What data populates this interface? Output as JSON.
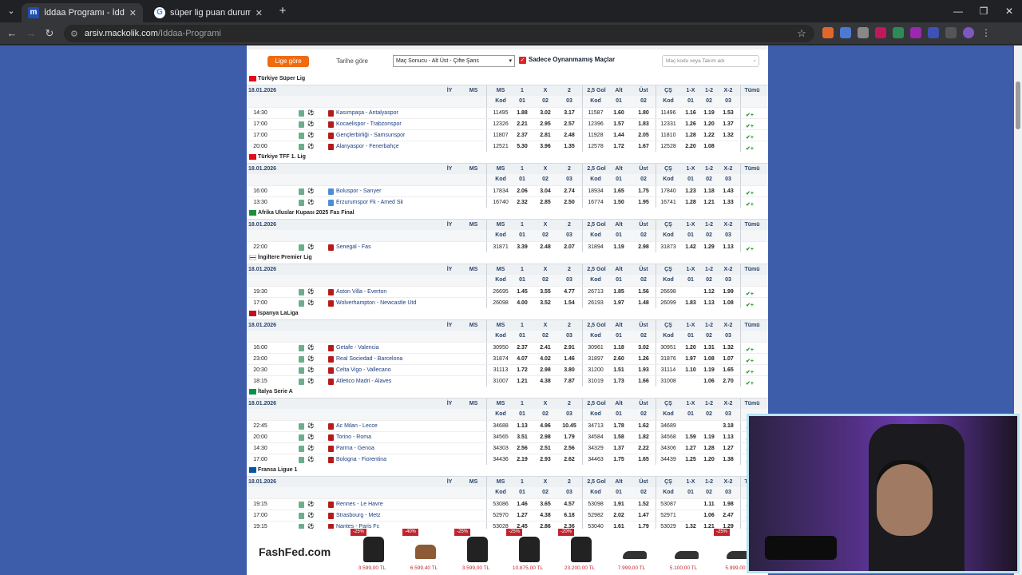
{
  "tabs": [
    {
      "title": "İddaa Programı - İddaa sonuçları",
      "icon": "mackolik-favicon"
    },
    {
      "title": "süper lig puan durum - Google Arama",
      "icon": "google-favicon"
    }
  ],
  "address": {
    "domain": "arsiv.mackolik.com",
    "path": "/Iddaa-Programi"
  },
  "filters": {
    "lige_gore": "Lige göre",
    "tarihe_gore": "Tarihe göre",
    "market_select": "Maç Sonucu - Alt Üst - Çifte Şans",
    "only_unplayed": "Sadece Oynanmamış Maçlar",
    "search_placeholder": "Maç kodu veya Takım adı"
  },
  "headers": {
    "iy": "İY",
    "ms": "MS",
    "ms2": "MS",
    "one": "1",
    "x": "X",
    "two": "2",
    "gol": "2,5 Gol",
    "alt": "Alt",
    "ust": "Üst",
    "cs": "ÇŞ",
    "one_x": "1-X",
    "one_two": "1-2",
    "x_two": "X-2",
    "all": "Tümü",
    "kod": "Kod",
    "c01": "01",
    "c02": "02",
    "c03": "03"
  },
  "leagues": [
    {
      "name": "Türkiye Süper Lig",
      "flag": "tr",
      "date": "18.01.2026",
      "matches": [
        [
          "14:30",
          "Kasımpaşa - Antalyaspor",
          "11495",
          "1.88",
          "3.02",
          "3.17",
          "11587",
          "1.60",
          "1.80",
          "11496",
          "1.16",
          "1.19",
          "1.53"
        ],
        [
          "17:00",
          "Kocaelispor - Trabzonspor",
          "12326",
          "2.21",
          "2.95",
          "2.57",
          "12396",
          "1.57",
          "1.83",
          "12331",
          "1.26",
          "1.20",
          "1.37"
        ],
        [
          "17:00",
          "Gençlerbirliği - Samsunspor",
          "11807",
          "2.37",
          "2.81",
          "2.48",
          "11928",
          "1.44",
          "2.05",
          "11810",
          "1.28",
          "1.22",
          "1.32"
        ],
        [
          "20:00",
          "Alanyaspor - Fenerbahçe",
          "12521",
          "5.30",
          "3.96",
          "1.35",
          "12578",
          "1.72",
          "1.67",
          "12528",
          "2.20",
          "1.08",
          ""
        ]
      ]
    },
    {
      "name": "Türkiye TFF 1. Lig",
      "flag": "tr",
      "date": "18.01.2026",
      "matches": [
        [
          "16:00",
          "Boluspor - Sarıyer",
          "17834",
          "2.06",
          "3.04",
          "2.74",
          "18934",
          "1.65",
          "1.75",
          "17840",
          "1.23",
          "1.18",
          "1.43"
        ],
        [
          "13:30",
          "Erzurumspor Fk - Amed Sk",
          "16740",
          "2.32",
          "2.85",
          "2.50",
          "16774",
          "1.50",
          "1.95",
          "16741",
          "1.28",
          "1.21",
          "1.33"
        ]
      ]
    },
    {
      "name": "Afrika Uluslar Kupası 2025 Fas Final",
      "flag": "af",
      "date": "18.01.2026",
      "matches": [
        [
          "22:00",
          "Senegal - Fas",
          "31871",
          "3.39",
          "2.48",
          "2.07",
          "31894",
          "1.19",
          "2.98",
          "31873",
          "1.42",
          "1.29",
          "1.13"
        ]
      ]
    },
    {
      "name": "İngiltere Premier Lig",
      "flag": "en",
      "date": "18.01.2026",
      "matches": [
        [
          "19:30",
          "Aston Villa - Everton",
          "26695",
          "1.45",
          "3.55",
          "4.77",
          "26713",
          "1.85",
          "1.56",
          "26698",
          "",
          "1.12",
          "1.99"
        ],
        [
          "17:00",
          "Wolverhampton - Newcastle Utd",
          "26098",
          "4.00",
          "3.52",
          "1.54",
          "26193",
          "1.97",
          "1.48",
          "26099",
          "1.83",
          "1.13",
          "1.08"
        ]
      ]
    },
    {
      "name": "İspanya LaLiga",
      "flag": "es",
      "date": "18.01.2026",
      "matches": [
        [
          "16:00",
          "Getafe - Valencia",
          "30950",
          "2.37",
          "2.41",
          "2.91",
          "30961",
          "1.18",
          "3.02",
          "30951",
          "1.20",
          "1.31",
          "1.32"
        ],
        [
          "23:00",
          "Real Sociedad - Barcelona",
          "31874",
          "4.07",
          "4.02",
          "1.46",
          "31897",
          "2.60",
          "1.26",
          "31876",
          "1.97",
          "1.08",
          "1.07"
        ],
        [
          "20:30",
          "Celta Vigo - Vallecano",
          "31113",
          "1.72",
          "2.98",
          "3.80",
          "31200",
          "1.51",
          "1.93",
          "31114",
          "1.10",
          "1.19",
          "1.65"
        ],
        [
          "18:15",
          "Atletico Madri - Alaves",
          "31007",
          "1.21",
          "4.38",
          "7.87",
          "31019",
          "1.73",
          "1.66",
          "31008",
          "",
          "1.06",
          "2.70"
        ]
      ]
    },
    {
      "name": "İtalya Serie A",
      "flag": "it",
      "date": "18.01.2026",
      "matches": [
        [
          "22:45",
          "Ac Milan - Lecce",
          "34688",
          "1.13",
          "4.96",
          "10.45",
          "34713",
          "1.78",
          "1.62",
          "34689",
          "",
          "",
          "3.18"
        ],
        [
          "20:00",
          "Torino - Roma",
          "34565",
          "3.51",
          "2.98",
          "1.79",
          "34584",
          "1.58",
          "1.82",
          "34568",
          "1.59",
          "1.19",
          "1.13"
        ],
        [
          "14:30",
          "Parma - Genoa",
          "34303",
          "2.56",
          "2.51",
          "2.56",
          "34329",
          "1.37",
          "2.22",
          "34306",
          "1.27",
          "1.28",
          "1.27"
        ],
        [
          "17:00",
          "Bologna - Fiorentina",
          "34436",
          "2.19",
          "2.93",
          "2.62",
          "34463",
          "1.75",
          "1.65",
          "34439",
          "1.25",
          "1.20",
          "1.38"
        ]
      ]
    },
    {
      "name": "Fransa Ligue 1",
      "flag": "fr",
      "date": "18.01.2026",
      "matches": [
        [
          "19:15",
          "Rennes - Le Havre",
          "53086",
          "1.46",
          "3.65",
          "4.57",
          "53098",
          "1.91",
          "1.52",
          "53087",
          "",
          "1.11",
          "1.98"
        ],
        [
          "17:00",
          "Strasbourg - Metz",
          "52970",
          "1.27",
          "4.38",
          "6.18",
          "52982",
          "2.02",
          "1.47",
          "52971",
          "",
          "1.06",
          "2.47"
        ],
        [
          "19:15",
          "Nantes - Paris Fc",
          "53028",
          "2.45",
          "2.86",
          "2.36",
          "53040",
          "1.61",
          "1.79",
          "53029",
          "1.32",
          "1.21",
          "1.29"
        ]
      ]
    }
  ],
  "ad": {
    "logo": "FashFed.com",
    "products": [
      {
        "discount": "-25%",
        "price": "3.599,00 TL",
        "kind": "jacket"
      },
      {
        "discount": "-40%",
        "price": "6.599,40 TL",
        "kind": "boot"
      },
      {
        "discount": "-25%",
        "price": "3.599,00 TL",
        "kind": "jacket"
      },
      {
        "discount": "-25%",
        "price": "10.875,00 TL",
        "kind": "coat"
      },
      {
        "discount": "-20%",
        "price": "23.200,00 TL",
        "kind": "jacket"
      },
      {
        "discount": "",
        "price": "7.999,00 TL",
        "kind": "shoe"
      },
      {
        "discount": "",
        "price": "5.100,00 TL",
        "kind": "shoe"
      },
      {
        "discount": "-25%",
        "price": "5.999,00",
        "kind": "shoe"
      }
    ]
  },
  "colors": {
    "accent": "#f06a10",
    "page_bg": "#3d5ca9",
    "header_text": "#2c4468"
  }
}
